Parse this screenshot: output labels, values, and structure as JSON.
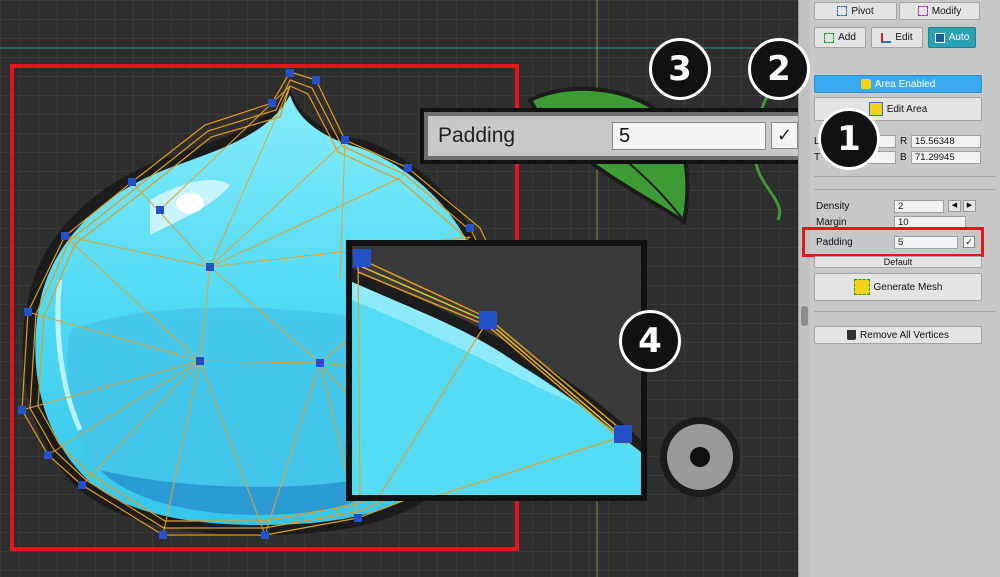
{
  "toolbar": {
    "pivot_label": "Pivot",
    "modify_label": "Modify",
    "add_label": "Add",
    "edit_label": "Edit",
    "auto_label": "Auto"
  },
  "area": {
    "enabled_label": "Area Enabled",
    "edit_label": "Edit Area",
    "l_label": "L",
    "r_label": "R",
    "r_value": "15.56348",
    "t_label": "T",
    "b_label": "B",
    "b_value": "71.29945"
  },
  "mesh_settings": {
    "density_label": "Density",
    "density_value": "2",
    "margin_label": "Margin",
    "margin_value": "10",
    "padding_label": "Padding",
    "padding_value": "5",
    "padding_checked": "✓",
    "default_label": "Default",
    "generate_label": "Generate Mesh",
    "remove_label": "Remove All Vertices"
  },
  "callout": {
    "label": "Padding",
    "value": "5",
    "checked": "✓"
  },
  "step_badges": [
    "1",
    "2",
    "3",
    "4"
  ],
  "colors": {
    "highlight_red": "#e8141c",
    "area_enabled_blue": "#3aaaf0",
    "auto_teal": "#2aa1b3",
    "arrow_yellow": "#f5c400",
    "mesh_edge": "#e39b1c",
    "vertex_blue": "#2450c8",
    "slime_cyan": "#4fd9f4"
  },
  "icons": [
    "pivot-icon",
    "modify-icon",
    "add-icon",
    "edit-icon",
    "auto-icon",
    "star-icon",
    "edit-area-icon",
    "generate-mesh-icon",
    "trash-icon",
    "left-arrow-icon",
    "right-arrow-icon",
    "checkmark-icon"
  ]
}
